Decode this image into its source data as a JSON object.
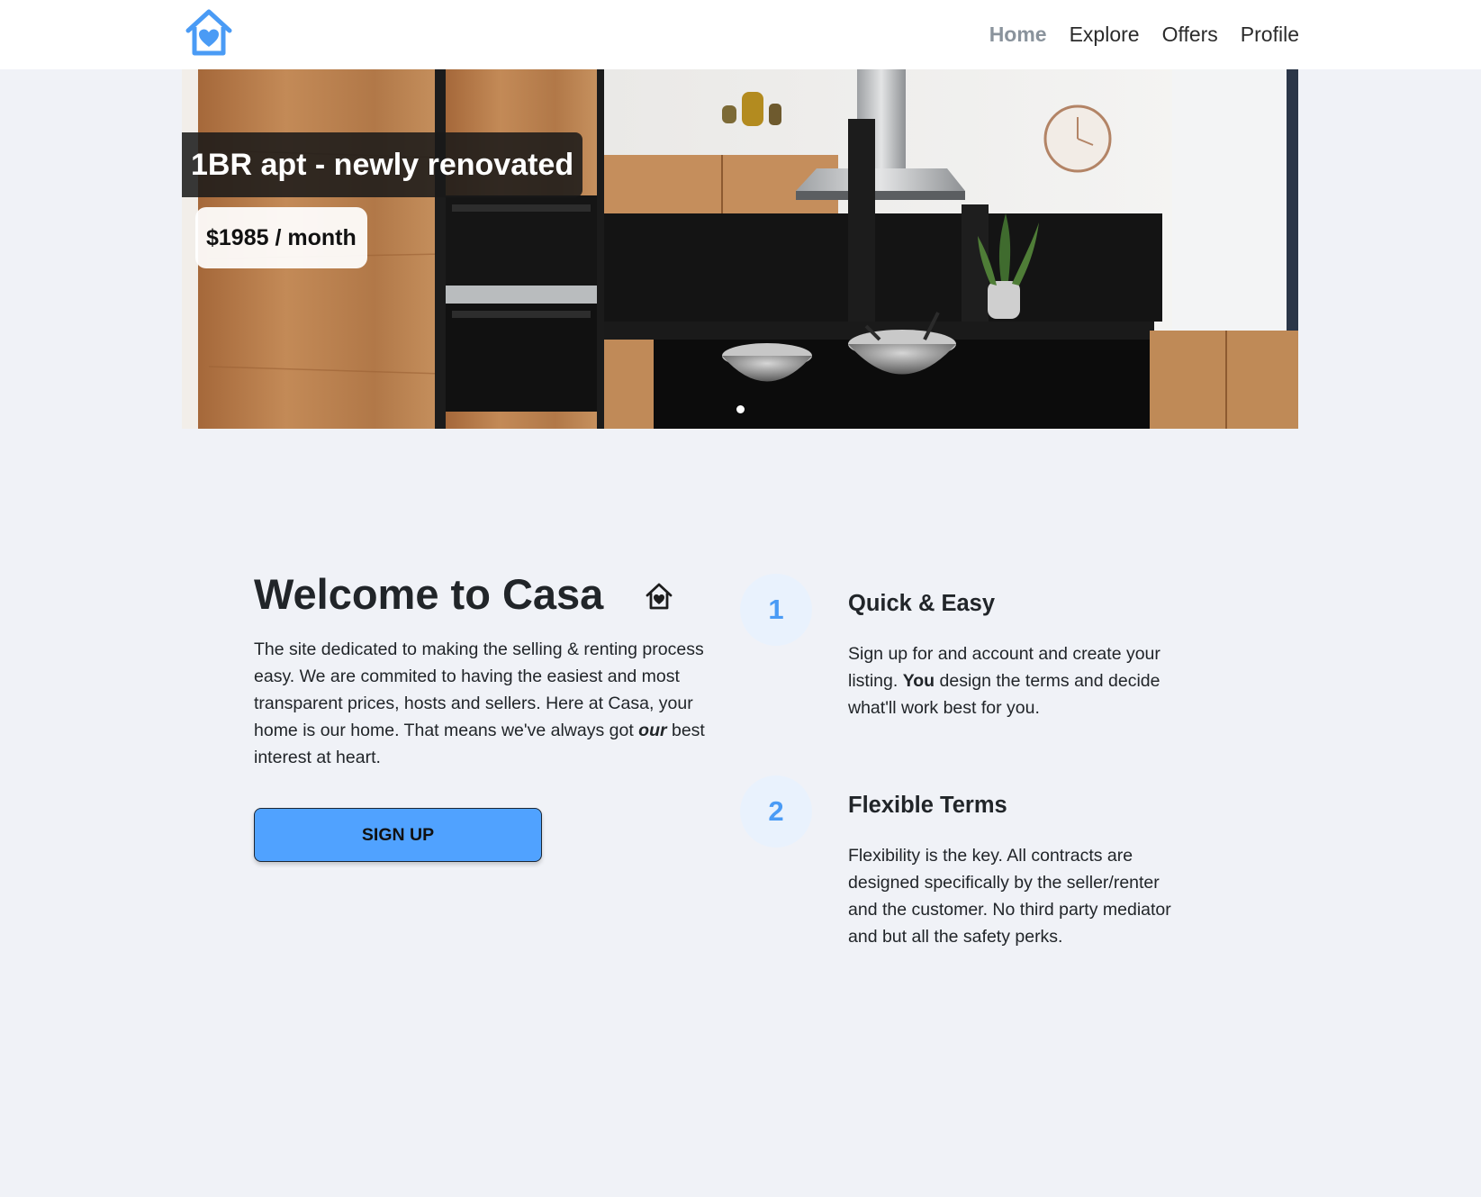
{
  "nav": {
    "logo_icon": "house-heart-icon",
    "items": [
      {
        "label": "Home",
        "active": true
      },
      {
        "label": "Explore",
        "active": false
      },
      {
        "label": "Offers",
        "active": false
      },
      {
        "label": "Profile",
        "active": false
      }
    ]
  },
  "hero": {
    "title": "1BR apt - newly renovated",
    "price": "$1985 / month",
    "slide_index": 1
  },
  "welcome": {
    "title": "Welcome to Casa",
    "icon": "house-heart-icon",
    "text_part1": "The site dedicated to making the selling & renting process easy. We are commited to having the easiest and most transparent prices, hosts and sellers. Here at Casa, your home is our home. That means we've always got ",
    "text_emphasis": "our",
    "text_part2": " best interest at heart.",
    "button_label": "SIGN UP"
  },
  "features": [
    {
      "number": "1",
      "title": "Quick & Easy",
      "text_part1": "Sign up for and account and create your listing. ",
      "text_bold": "You",
      "text_part2": " design the terms and decide what'll work best for you."
    },
    {
      "number": "2",
      "title": "Flexible Terms",
      "text": "Flexibility is the key. All contracts are designed specifically by the seller/renter and the customer. No third party mediator and but all the safety perks."
    }
  ],
  "colors": {
    "accent": "#50a2ff",
    "feature_number": "#4a9bf5",
    "feature_circle": "#e9f2fd",
    "page_bg": "#f0f2f7"
  }
}
